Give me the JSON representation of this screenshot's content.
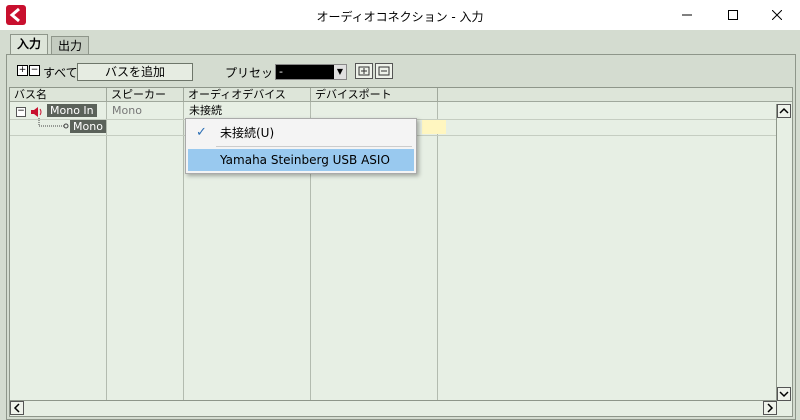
{
  "window": {
    "title": "オーディオコネクション - 入力"
  },
  "tabs": [
    {
      "label": "入力"
    },
    {
      "label": "出力"
    }
  ],
  "toolbar": {
    "all_label": "すべて",
    "add_bus_label": "バスを追加",
    "preset_label": "プリセット",
    "preset_value": "-"
  },
  "columns": [
    {
      "label": "バス名"
    },
    {
      "label": "スピーカー"
    },
    {
      "label": "オーディオデバイス"
    },
    {
      "label": "デバイスポート"
    }
  ],
  "rows": [
    {
      "bus_name": "Mono In",
      "speaker": "Mono",
      "device": "未接続",
      "port": ""
    },
    {
      "bus_name": "Mono",
      "speaker": "",
      "device": "",
      "port": ""
    }
  ],
  "dropdown": {
    "items": [
      {
        "label": "未接続(U)",
        "checked": true
      },
      {
        "label": "Yamaha Steinberg USB ASIO",
        "checked": false
      }
    ]
  },
  "colors": {
    "accent": "#c8102e",
    "selection": "#99c9ef"
  }
}
